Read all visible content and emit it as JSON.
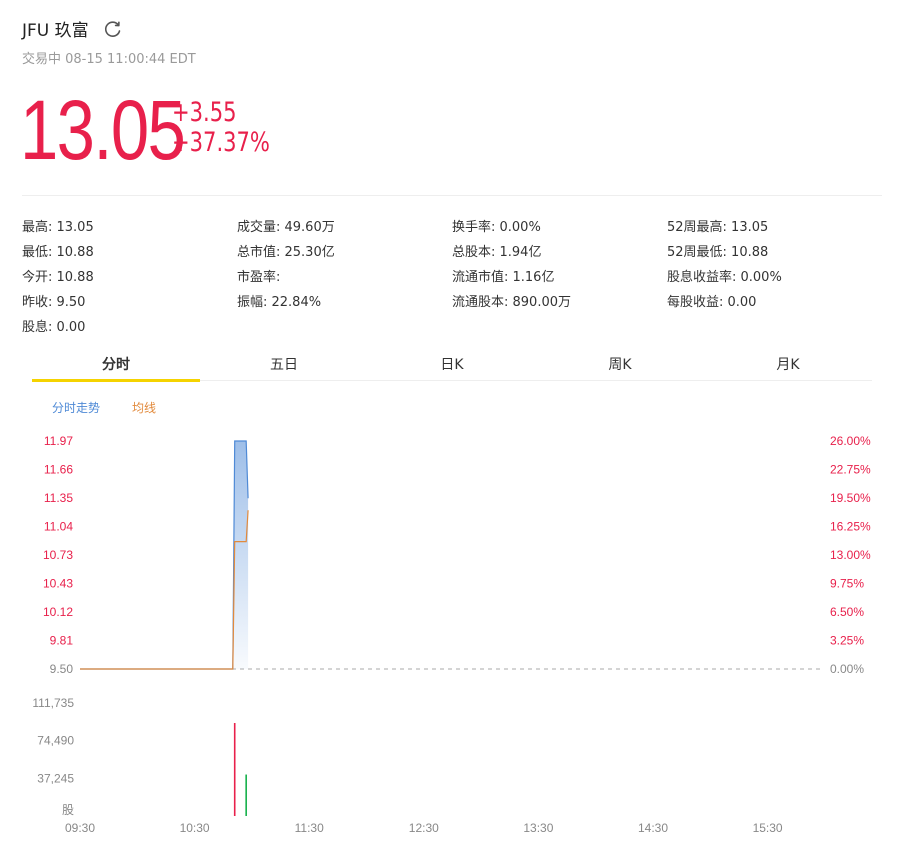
{
  "header": {
    "title": "JFU 玖富",
    "status": "交易中 08-15 11:00:44 EDT"
  },
  "quote": {
    "price": "13.05",
    "change": "+3.55",
    "change_pct": "+37.37%"
  },
  "stats": {
    "col1": [
      "最高: 13.05",
      "最低: 10.88",
      "今开: 10.88",
      "昨收: 9.50",
      "股息: 0.00"
    ],
    "col2": [
      "成交量: 49.60万",
      "总市值: 25.30亿",
      "市盈率:",
      "振幅: 22.84%"
    ],
    "col3": [
      "换手率: 0.00%",
      "总股本: 1.94亿",
      "流通市值: 1.16亿",
      "流通股本: 890.00万"
    ],
    "col4": [
      "52周最高: 13.05",
      "52周最低: 10.88",
      "股息收益率: 0.00%",
      "每股收益: 0.00"
    ]
  },
  "tabs": [
    "分时",
    "五日",
    "日K",
    "周K",
    "月K"
  ],
  "active_tab": 0,
  "legend": {
    "price_label": "分时走势",
    "avg_label": "均线",
    "price_color": "#4f8ad6",
    "avg_color": "#e28a3c"
  },
  "colors": {
    "up": "#e8204b",
    "down": "#15b04a",
    "axis_text": "#888888"
  },
  "chart_data": {
    "type": "line",
    "x_ticks": [
      "09:30",
      "10:30",
      "11:30",
      "12:30",
      "13:30",
      "14:30",
      "15:30"
    ],
    "price_ticks": [
      "11.97",
      "11.66",
      "11.35",
      "11.04",
      "10.73",
      "10.43",
      "10.12",
      "9.81",
      "9.50"
    ],
    "pct_ticks": [
      "26.00%",
      "22.75%",
      "19.50%",
      "16.25%",
      "13.00%",
      "9.75%",
      "6.50%",
      "3.25%",
      "0.00%"
    ],
    "ylim": [
      9.5,
      11.97
    ],
    "prev_close": 9.5,
    "series": [
      {
        "name": "分时走势",
        "x": [
          "09:30",
          "10:50",
          "10:51",
          "10:52",
          "10:57",
          "10:58"
        ],
        "values": [
          9.5,
          9.5,
          11.97,
          11.97,
          11.97,
          11.35
        ]
      },
      {
        "name": "均线",
        "x": [
          "09:30",
          "10:50",
          "10:51",
          "10:57",
          "10:58"
        ],
        "values": [
          9.5,
          9.5,
          10.88,
          10.88,
          11.22
        ]
      }
    ],
    "volume": {
      "ticks": [
        "111,735",
        "74,490",
        "37,245"
      ],
      "unit": "股",
      "ylim": [
        0,
        111735
      ],
      "bars": [
        {
          "x": "10:51",
          "value": 92000,
          "dir": "up"
        },
        {
          "x": "10:57",
          "value": 41000,
          "dir": "down"
        }
      ]
    }
  }
}
